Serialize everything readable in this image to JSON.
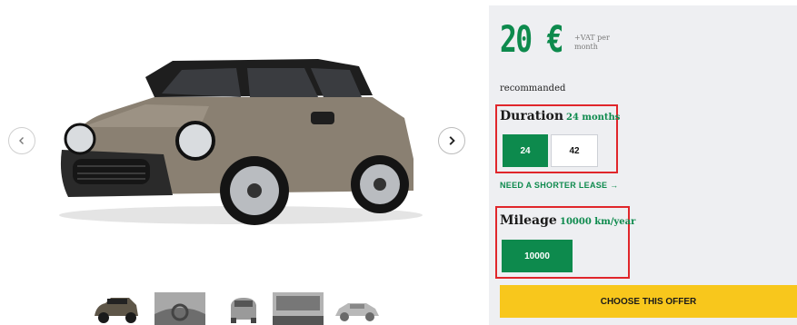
{
  "gallery": {
    "prev_icon": "chevron-left-icon",
    "next_icon": "chevron-right-icon",
    "thumbnail_count": 5
  },
  "offer": {
    "price": "20 €",
    "price_note": "+VAT per month",
    "recommended_label": "recommanded",
    "duration": {
      "title": "Duration",
      "value": "24 months",
      "options": [
        "24",
        "42"
      ],
      "selected": "24"
    },
    "shorter_lease_link": "NEED A SHORTER LEASE →",
    "mileage": {
      "title": "Mileage",
      "value": "10000 km/year",
      "options": [
        "10000"
      ],
      "selected": "10000"
    },
    "cta_label": "CHOOSE THIS OFFER"
  },
  "colors": {
    "brand_green": "#0d8a4d",
    "cta_yellow": "#f8c71c",
    "highlight_red": "#e0262b",
    "panel_bg": "#eeeff2"
  }
}
